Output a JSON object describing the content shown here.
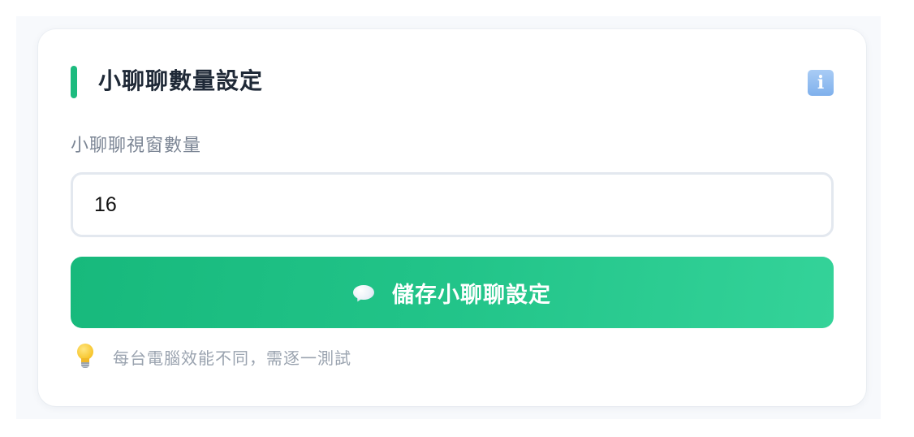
{
  "section": {
    "title": "小聊聊數量設定",
    "info_icon": "info-icon",
    "accent_color": "#1dbb7f"
  },
  "field": {
    "label": "小聊聊視窗數量",
    "value": "16"
  },
  "save_button": {
    "icon": "speech-bubble-icon",
    "label": "儲存小聊聊設定",
    "color": "#22c489"
  },
  "tip": {
    "icon": "light-bulb-icon",
    "text": "每台電腦效能不同，需逐一測試"
  }
}
